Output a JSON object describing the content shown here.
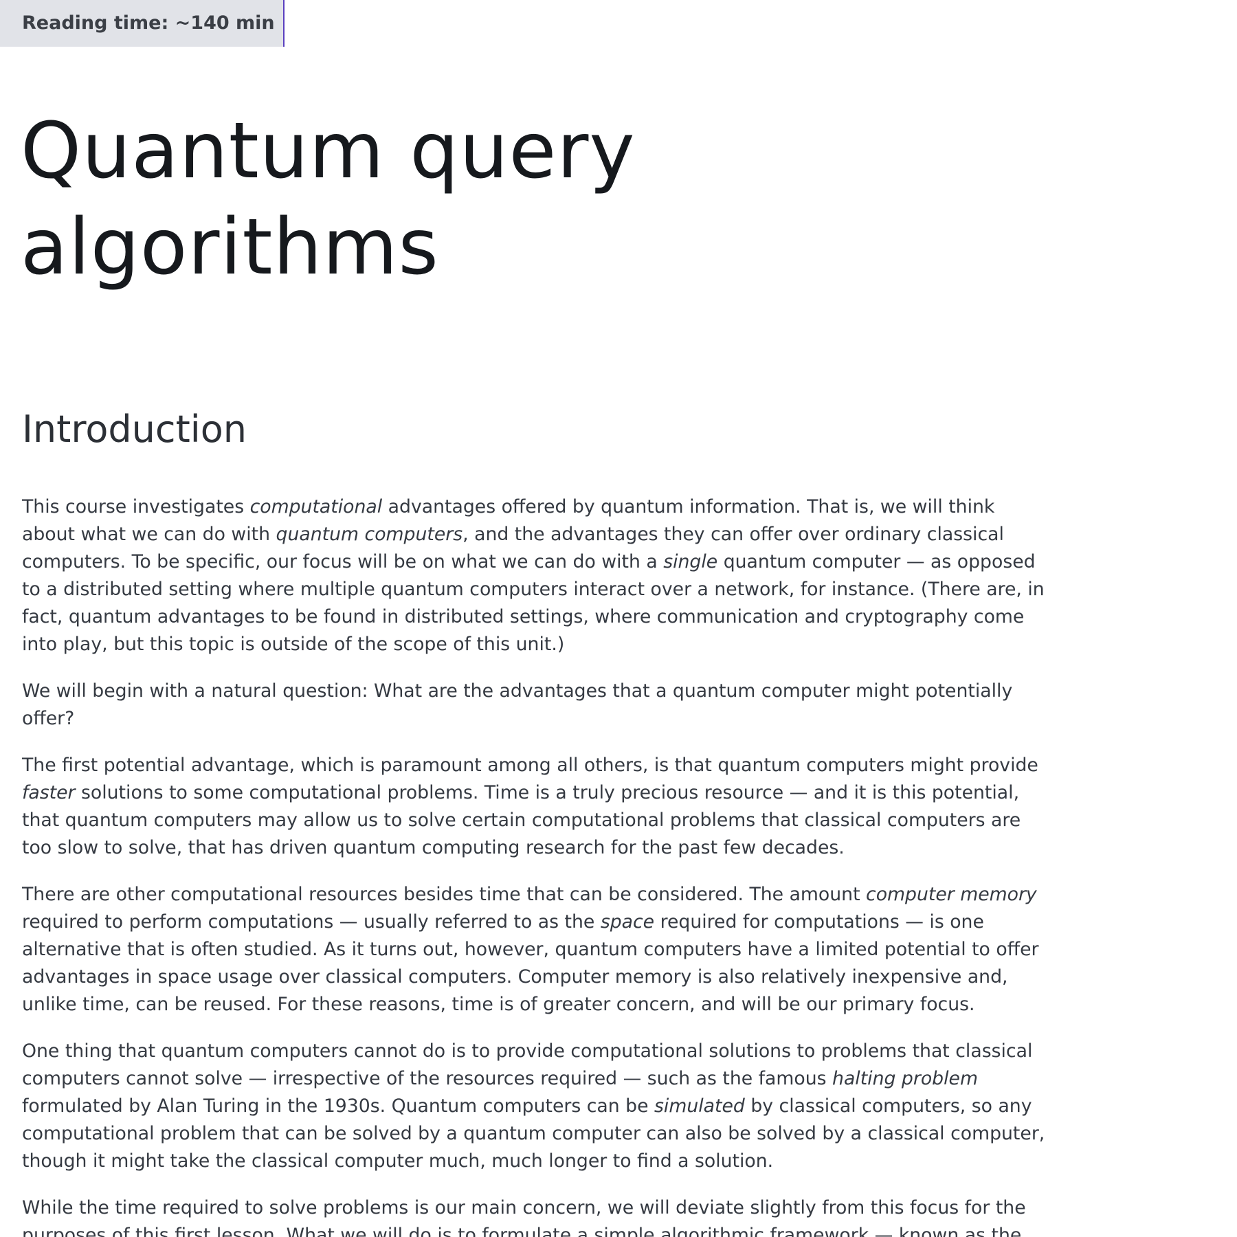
{
  "header": {
    "reading_time": "Reading time: ~140 min"
  },
  "page": {
    "title_line1": "Quantum query",
    "title_line2": "algorithms",
    "section_heading": "Introduction"
  },
  "paragraphs": [
    [
      [
        "This course investigates ",
        "computational",
        " advantages offered by quantum information. That is, we will think"
      ],
      [
        "about what we can do with ",
        "quantum computers",
        ", and the advantages they can offer over ordinary classical"
      ],
      [
        "computers. To be specific, our focus will be on what we can do with a ",
        "single",
        " quantum computer — as opposed"
      ],
      [
        "to a distributed setting where multiple quantum computers interact over a network, for instance. (There are, in"
      ],
      [
        "fact, quantum advantages to be found in distributed settings, where communication and cryptography come"
      ],
      [
        "into play, but this topic is outside of the scope of this unit.)"
      ]
    ],
    [
      [
        "We will begin with a natural question: What are the advantages that a quantum computer might potentially"
      ],
      [
        "offer?"
      ]
    ],
    [
      [
        "The first potential advantage, which is paramount among all others, is that quantum computers might provide"
      ],
      [
        "",
        "faster",
        " solutions to some computational problems. Time is a truly precious resource — and it is this potential,"
      ],
      [
        "that quantum computers may allow us to solve certain computational problems that classical computers are"
      ],
      [
        "too slow to solve, that has driven quantum computing research for the past few decades."
      ]
    ],
    [
      [
        "There are other computational resources besides time that can be considered. The amount ",
        "computer memory",
        ""
      ],
      [
        "required to perform computations — usually referred to as the ",
        "space",
        " required for computations — is one"
      ],
      [
        "alternative that is often studied. As it turns out, however, quantum computers have a limited potential to offer"
      ],
      [
        "advantages in space usage over classical computers. Computer memory is also relatively inexpensive and,"
      ],
      [
        "unlike time, can be reused. For these reasons, time is of greater concern, and will be our primary focus."
      ]
    ],
    [
      [
        "One thing that quantum computers cannot do is to provide computational solutions to problems that classical"
      ],
      [
        "computers cannot solve — irrespective of the resources required — such as the famous ",
        "halting problem",
        ""
      ],
      [
        "formulated by Alan Turing in the 1930s. Quantum computers can be ",
        "simulated",
        " by classical computers, so any"
      ],
      [
        "computational problem that can be solved by a quantum computer can also be solved by a classical computer,"
      ],
      [
        "though it might take the classical computer much, much longer to find a solution."
      ]
    ],
    [
      [
        "While the time required to solve problems is our main concern, we will deviate slightly from this focus for the"
      ],
      [
        "purposes of this first lesson. What we will do is to formulate a simple algorithmic framework — known as the"
      ]
    ]
  ]
}
